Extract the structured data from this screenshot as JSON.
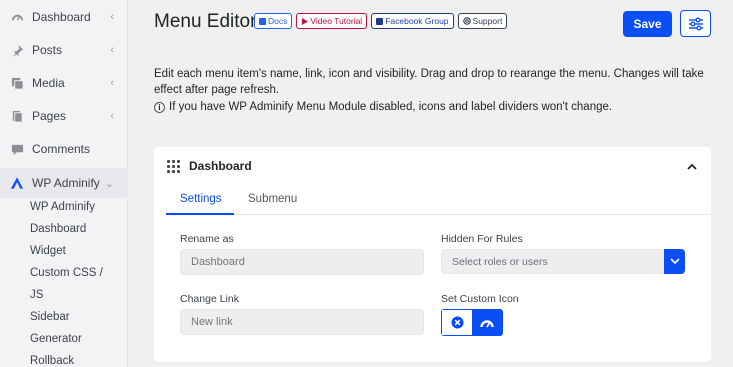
{
  "sidebar": {
    "items": [
      {
        "label": "Dashboard",
        "icon": "dashboard-icon",
        "chevron": "‹"
      },
      {
        "label": "Posts",
        "icon": "pin-icon",
        "chevron": "‹"
      },
      {
        "label": "Media",
        "icon": "media-icon",
        "chevron": "‹"
      },
      {
        "label": "Pages",
        "icon": "pages-icon",
        "chevron": "‹"
      },
      {
        "label": "Comments",
        "icon": "comments-icon"
      },
      {
        "label": "WP Adminify",
        "icon": "adminify-logo-icon",
        "chevron": "⌄"
      }
    ],
    "subitems": [
      "WP Adminify",
      "Dashboard",
      "Widget",
      "Custom CSS /",
      "JS",
      "Sidebar",
      "Generator",
      "Rollback"
    ]
  },
  "header": {
    "title": "Menu Editor",
    "badges": [
      {
        "label": "Docs",
        "icon": "docs-icon"
      },
      {
        "label": "Video Tutorial",
        "icon": "youtube-icon"
      },
      {
        "label": "Facebook Group",
        "icon": "facebook-icon"
      },
      {
        "label": "Support",
        "icon": "support-icon"
      }
    ],
    "save_label": "Save",
    "settings_icon": "sliders-icon"
  },
  "description": "Edit each menu item's name, link, icon and visibility. Drag and drop to rearange the menu. Changes will take effect after page refresh.",
  "note": "If you have WP Adminify Menu Module disabled, icons and label dividers won't change.",
  "panel": {
    "title": "Dashboard",
    "tabs": [
      "Settings",
      "Submenu"
    ],
    "active_tab": "Settings",
    "rename": {
      "label": "Rename as",
      "placeholder": "Dashboard"
    },
    "hidden_rules": {
      "label": "Hidden For Rules",
      "placeholder": "Select roles or users"
    },
    "change_link": {
      "label": "Change Link",
      "placeholder": "New link"
    },
    "custom_icon": {
      "label": "Set Custom Icon"
    }
  },
  "colors": {
    "accent": "#0a4ef5",
    "youtube": "#be123c",
    "facebook": "#1e3a8a"
  }
}
